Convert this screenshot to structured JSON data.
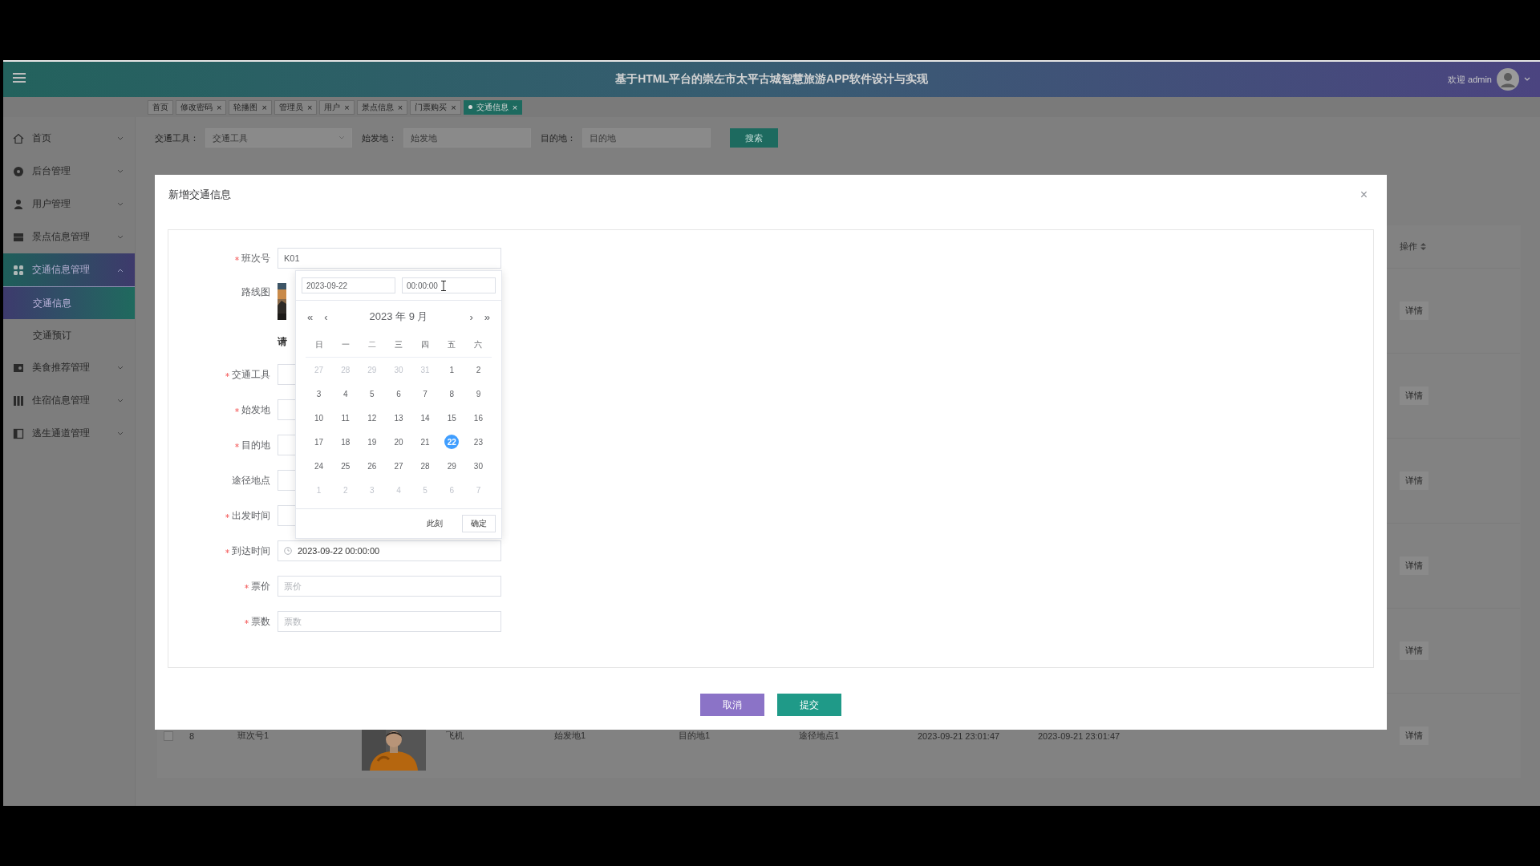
{
  "header": {
    "title": "基于HTML平台的崇左市太平古城智慧旅游APP软件设计与实现",
    "welcome": "欢迎 admin"
  },
  "tabs": [
    {
      "label": "首页",
      "selected": false
    },
    {
      "label": "修改密码",
      "close": "×",
      "selected": false
    },
    {
      "label": "轮播图",
      "close": "×",
      "selected": false
    },
    {
      "label": "管理员",
      "close": "×",
      "selected": false
    },
    {
      "label": "用户",
      "close": "×",
      "selected": false
    },
    {
      "label": "景点信息",
      "close": "×",
      "selected": false
    },
    {
      "label": "门票购买",
      "close": "×",
      "selected": false
    },
    {
      "label": "交通信息",
      "close": "×",
      "selected": true
    }
  ],
  "sidebar": {
    "items": [
      {
        "label": "首页",
        "expanded": false,
        "selected": false
      },
      {
        "label": "后台管理",
        "expanded": false,
        "selected": false
      },
      {
        "label": "用户管理",
        "expanded": false,
        "selected": false
      },
      {
        "label": "景点信息管理",
        "expanded": false,
        "selected": false
      },
      {
        "label": "交通信息管理",
        "expanded": true,
        "selected": true,
        "children": [
          {
            "label": "交通信息",
            "selected": true
          },
          {
            "label": "交通预订",
            "selected": false
          }
        ]
      },
      {
        "label": "美食推荐管理",
        "expanded": false,
        "selected": false
      },
      {
        "label": "住宿信息管理",
        "expanded": false,
        "selected": false
      },
      {
        "label": "逃生通道管理",
        "expanded": false,
        "selected": false
      }
    ]
  },
  "search": {
    "fields": [
      {
        "label": "交通工具：",
        "placeholder": "交通工具",
        "kind": "select"
      },
      {
        "label": "始发地：",
        "placeholder": "始发地",
        "kind": "text"
      },
      {
        "label": "目的地：",
        "placeholder": "目的地",
        "kind": "text"
      }
    ],
    "button": "搜索"
  },
  "table": {
    "action_column": "操作",
    "rows": [
      {
        "action": "详情"
      },
      {
        "action": "详情"
      },
      {
        "action": "详情"
      },
      {
        "action": "详情"
      },
      {
        "action": "详情"
      },
      {
        "checked": false,
        "cells": [
          "8",
          "班次号1",
          "飞机",
          "始发地1",
          "目的地1",
          "途径地点1",
          "2023-09-21 23:01:47",
          "2023-09-21 23:01:47"
        ],
        "action": "详情"
      }
    ]
  },
  "dialog": {
    "title": "新增交通信息",
    "close": "×",
    "fields": [
      {
        "label": "班次号",
        "required": true,
        "kind": "text",
        "value": "K01"
      },
      {
        "label": "路线图",
        "required": false,
        "kind": "upload",
        "hint": "请"
      },
      {
        "label": "交通工具",
        "required": true,
        "kind": "select"
      },
      {
        "label": "始发地",
        "required": true,
        "kind": "text"
      },
      {
        "label": "目的地",
        "required": true,
        "kind": "text"
      },
      {
        "label": "途径地点",
        "required": false,
        "kind": "text"
      },
      {
        "label": "出发时间",
        "required": true,
        "kind": "datetime"
      },
      {
        "label": "到达时间",
        "required": true,
        "kind": "datetime",
        "value": "2023-09-22 00:00:00"
      },
      {
        "label": "票价",
        "required": true,
        "kind": "text",
        "placeholder": "票价"
      },
      {
        "label": "票数",
        "required": true,
        "kind": "text",
        "placeholder": "票数"
      }
    ],
    "buttons": [
      {
        "label": "取消",
        "kind": "cancel"
      },
      {
        "label": "提交",
        "kind": "submit"
      }
    ]
  },
  "datepicker": {
    "date": "2023-09-22",
    "time": "00:00:00",
    "title": "2023 年 9 月",
    "nav": [
      "«",
      "‹",
      "›",
      "»"
    ],
    "weekdays": [
      "日",
      "一",
      "二",
      "三",
      "四",
      "五",
      "六"
    ],
    "days": [
      {
        "label": "27",
        "outside": true,
        "selected": false
      },
      {
        "label": "28",
        "outside": true,
        "selected": false
      },
      {
        "label": "29",
        "outside": true,
        "selected": false
      },
      {
        "label": "30",
        "outside": true,
        "selected": false
      },
      {
        "label": "31",
        "outside": true,
        "selected": false
      },
      {
        "label": "1",
        "outside": false,
        "selected": false
      },
      {
        "label": "2",
        "outside": false,
        "selected": false
      },
      {
        "label": "3",
        "outside": false,
        "selected": false
      },
      {
        "label": "4",
        "outside": false,
        "selected": false
      },
      {
        "label": "5",
        "outside": false,
        "selected": false
      },
      {
        "label": "6",
        "outside": false,
        "selected": false
      },
      {
        "label": "7",
        "outside": false,
        "selected": false
      },
      {
        "label": "8",
        "outside": false,
        "selected": false
      },
      {
        "label": "9",
        "outside": false,
        "selected": false
      },
      {
        "label": "10",
        "outside": false,
        "selected": false
      },
      {
        "label": "11",
        "outside": false,
        "selected": false
      },
      {
        "label": "12",
        "outside": false,
        "selected": false
      },
      {
        "label": "13",
        "outside": false,
        "selected": false
      },
      {
        "label": "14",
        "outside": false,
        "selected": false
      },
      {
        "label": "15",
        "outside": false,
        "selected": false
      },
      {
        "label": "16",
        "outside": false,
        "selected": false
      },
      {
        "label": "17",
        "outside": false,
        "selected": false
      },
      {
        "label": "18",
        "outside": false,
        "selected": false
      },
      {
        "label": "19",
        "outside": false,
        "selected": false
      },
      {
        "label": "20",
        "outside": false,
        "selected": false
      },
      {
        "label": "21",
        "outside": false,
        "selected": false
      },
      {
        "label": "22",
        "outside": false,
        "selected": true
      },
      {
        "label": "23",
        "outside": false,
        "selected": false
      },
      {
        "label": "24",
        "outside": false,
        "selected": false
      },
      {
        "label": "25",
        "outside": false,
        "selected": false
      },
      {
        "label": "26",
        "outside": false,
        "selected": false
      },
      {
        "label": "27",
        "outside": false,
        "selected": false
      },
      {
        "label": "28",
        "outside": false,
        "selected": false
      },
      {
        "label": "29",
        "outside": false,
        "selected": false
      },
      {
        "label": "30",
        "outside": false,
        "selected": false
      },
      {
        "label": "1",
        "outside": true,
        "selected": false
      },
      {
        "label": "2",
        "outside": true,
        "selected": false
      },
      {
        "label": "3",
        "outside": true,
        "selected": false
      },
      {
        "label": "4",
        "outside": true,
        "selected": false
      },
      {
        "label": "5",
        "outside": true,
        "selected": false
      },
      {
        "label": "6",
        "outside": true,
        "selected": false
      },
      {
        "label": "7",
        "outside": true,
        "selected": false
      }
    ],
    "now": "此刻",
    "confirm": "确定"
  }
}
